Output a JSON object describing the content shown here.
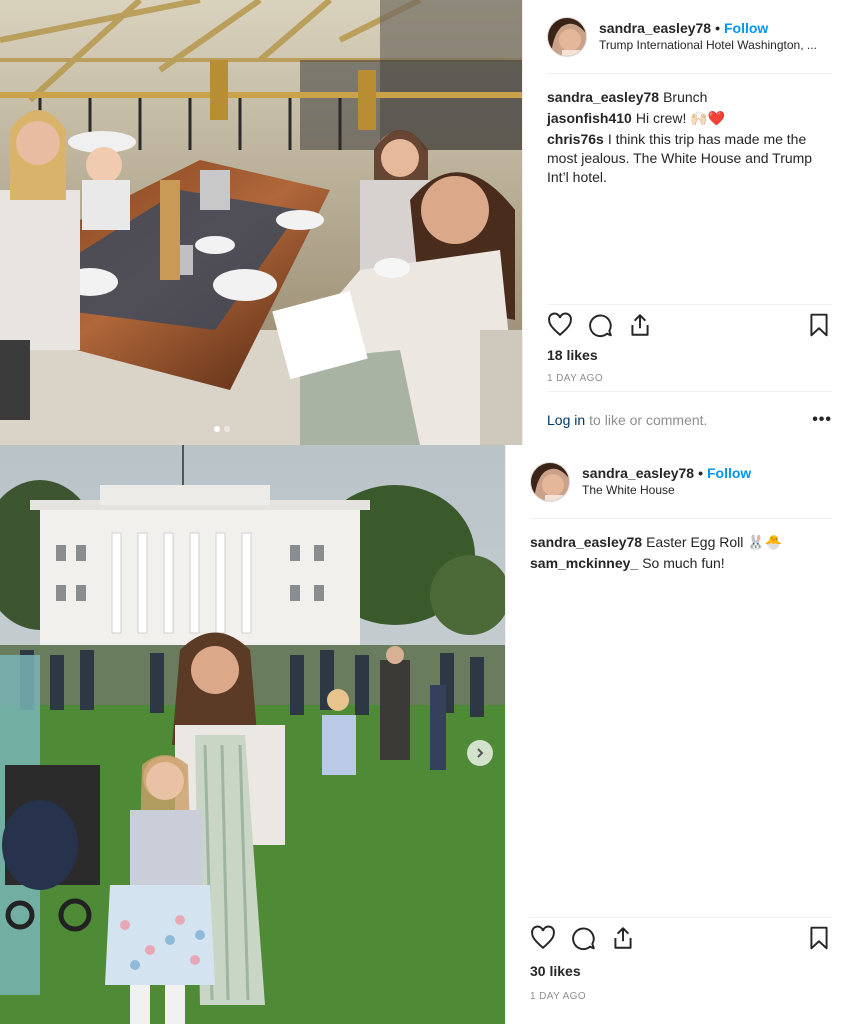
{
  "post1": {
    "username": "sandra_easley78",
    "separator": "•",
    "follow_label": "Follow",
    "location": "Trump International Hotel Washington, ...",
    "caption": {
      "user": "sandra_easley78",
      "text": "Brunch"
    },
    "comments": [
      {
        "user": "jasonfish410",
        "text": "Hi crew! 🙌🏻❤️"
      },
      {
        "user": "chris76s",
        "text": "I think this trip has made me the most jealous. The White House and Trump Int’l hotel."
      }
    ],
    "likes": "18 likes",
    "time_ago": "1 DAY AGO",
    "login_link": "Log in",
    "login_text": "to like or comment.",
    "more": "•••",
    "carousel": {
      "count": 2,
      "active": 1
    },
    "icons": [
      "heart-icon",
      "comment-icon",
      "share-icon",
      "bookmark-icon"
    ]
  },
  "post2": {
    "username": "sandra_easley78",
    "separator": "•",
    "follow_label": "Follow",
    "location": "The White House",
    "caption": {
      "user": "sandra_easley78",
      "text": "Easter Egg Roll 🐰🐣"
    },
    "comments": [
      {
        "user": "sam_mckinney_",
        "text": "So much fun!"
      }
    ],
    "likes": "30 likes",
    "time_ago": "1 DAY AGO",
    "icons": [
      "heart-icon",
      "comment-icon",
      "share-icon",
      "bookmark-icon",
      "chevron-right-icon"
    ]
  },
  "colors": {
    "link": "#0095f6",
    "login_link": "#00376b",
    "muted": "#8e8e8e",
    "border": "#dbdbdb"
  }
}
